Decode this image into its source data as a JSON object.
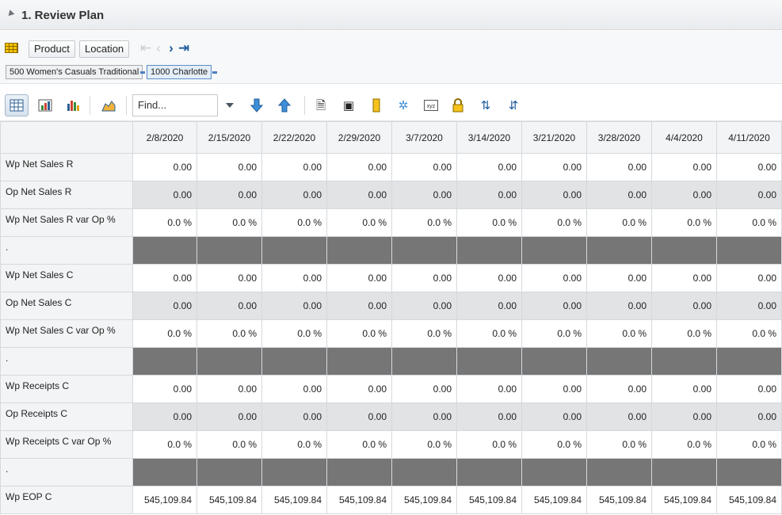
{
  "panel": {
    "title": "1. Review Plan"
  },
  "tiles": {
    "product_label": "Product",
    "location_label": "Location",
    "breadcrumbs": [
      "500 Women's Casuals Traditional",
      "1000 Charlotte"
    ]
  },
  "toolbar": {
    "find_placeholder": "Find..."
  },
  "grid": {
    "columns": [
      "2/8/2020",
      "2/15/2020",
      "2/22/2020",
      "2/29/2020",
      "3/7/2020",
      "3/14/2020",
      "3/21/2020",
      "3/28/2020",
      "4/4/2020",
      "4/11/2020"
    ],
    "rows": [
      {
        "label": "Wp Net Sales R",
        "style": "white",
        "values": [
          "0.00",
          "0.00",
          "0.00",
          "0.00",
          "0.00",
          "0.00",
          "0.00",
          "0.00",
          "0.00",
          "0.00"
        ]
      },
      {
        "label": "Op Net Sales R",
        "style": "gray",
        "values": [
          "0.00",
          "0.00",
          "0.00",
          "0.00",
          "0.00",
          "0.00",
          "0.00",
          "0.00",
          "0.00",
          "0.00"
        ]
      },
      {
        "label": "Wp Net Sales R var Op %",
        "style": "white",
        "values": [
          "0.0 %",
          "0.0 %",
          "0.0 %",
          "0.0 %",
          "0.0 %",
          "0.0 %",
          "0.0 %",
          "0.0 %",
          "0.0 %",
          "0.0 %"
        ]
      },
      {
        "label": ".",
        "style": "sep",
        "values": [
          "",
          "",
          "",
          "",
          "",
          "",
          "",
          "",
          "",
          ""
        ]
      },
      {
        "label": "Wp Net Sales C",
        "style": "white",
        "values": [
          "0.00",
          "0.00",
          "0.00",
          "0.00",
          "0.00",
          "0.00",
          "0.00",
          "0.00",
          "0.00",
          "0.00"
        ]
      },
      {
        "label": "Op Net Sales C",
        "style": "gray",
        "values": [
          "0.00",
          "0.00",
          "0.00",
          "0.00",
          "0.00",
          "0.00",
          "0.00",
          "0.00",
          "0.00",
          "0.00"
        ]
      },
      {
        "label": "Wp Net Sales C var Op %",
        "style": "white",
        "values": [
          "0.0 %",
          "0.0 %",
          "0.0 %",
          "0.0 %",
          "0.0 %",
          "0.0 %",
          "0.0 %",
          "0.0 %",
          "0.0 %",
          "0.0 %"
        ]
      },
      {
        "label": ".",
        "style": "sep",
        "values": [
          "",
          "",
          "",
          "",
          "",
          "",
          "",
          "",
          "",
          ""
        ]
      },
      {
        "label": "Wp Receipts C",
        "style": "white",
        "values": [
          "0.00",
          "0.00",
          "0.00",
          "0.00",
          "0.00",
          "0.00",
          "0.00",
          "0.00",
          "0.00",
          "0.00"
        ]
      },
      {
        "label": "Op Receipts C",
        "style": "gray",
        "values": [
          "0.00",
          "0.00",
          "0.00",
          "0.00",
          "0.00",
          "0.00",
          "0.00",
          "0.00",
          "0.00",
          "0.00"
        ]
      },
      {
        "label": "Wp Receipts C var Op %",
        "style": "white",
        "values": [
          "0.0 %",
          "0.0 %",
          "0.0 %",
          "0.0 %",
          "0.0 %",
          "0.0 %",
          "0.0 %",
          "0.0 %",
          "0.0 %",
          "0.0 %"
        ]
      },
      {
        "label": ".",
        "style": "sep",
        "values": [
          "",
          "",
          "",
          "",
          "",
          "",
          "",
          "",
          "",
          ""
        ]
      },
      {
        "label": "Wp EOP C",
        "style": "white",
        "values": [
          "545,109.84",
          "545,109.84",
          "545,109.84",
          "545,109.84",
          "545,109.84",
          "545,109.84",
          "545,109.84",
          "545,109.84",
          "545,109.84",
          "545,109.84"
        ]
      }
    ]
  }
}
